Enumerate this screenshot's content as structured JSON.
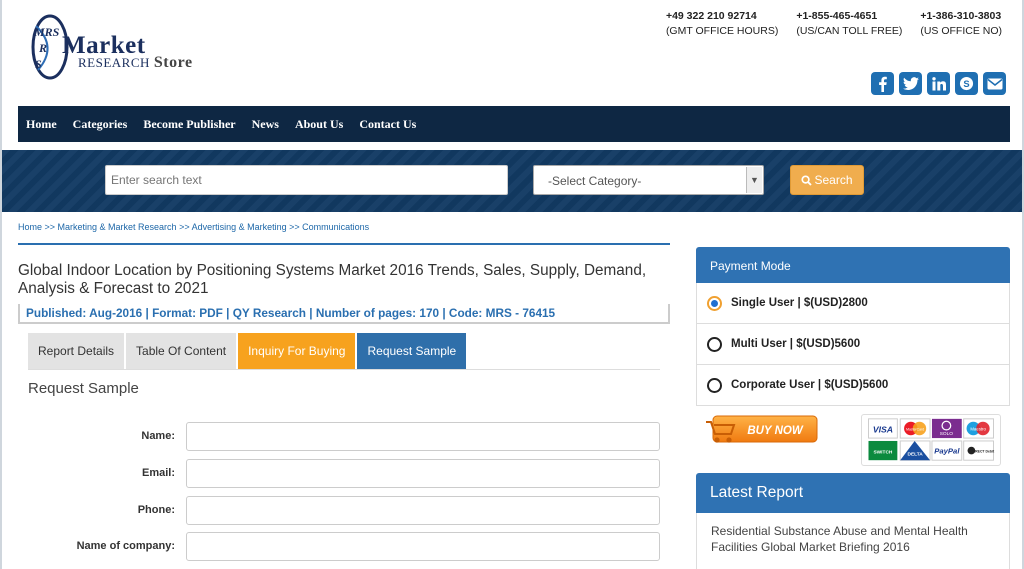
{
  "header": {
    "logo": {
      "mark": "MRS",
      "market": "Market",
      "research": "RESEARCH",
      "store": "Store"
    },
    "contacts": [
      {
        "number": "+49 322 210 92714",
        "note": "(GMT OFFICE HOURS)"
      },
      {
        "number": "+1-855-465-4651",
        "note": "(US/CAN TOLL FREE)"
      },
      {
        "number": "+1-386-310-3803",
        "note": "(US OFFICE NO)"
      }
    ],
    "socials": [
      "facebook-icon",
      "twitter-icon",
      "linkedin-icon",
      "skype-icon",
      "email-icon"
    ]
  },
  "nav": {
    "items": [
      "Home",
      "Categories",
      "Become Publisher",
      "News",
      "About Us",
      "Contact Us"
    ]
  },
  "search": {
    "placeholder": "Enter search text",
    "category": "-Select Category-",
    "button": "Search"
  },
  "breadcrumb": "Home >> Marketing & Market Research >> Advertising & Marketing >> Communications",
  "report": {
    "title": "Global Indoor Location by Positioning Systems Market 2016 Trends, Sales, Supply, Demand, Analysis & Forecast to 2021",
    "meta": "Published: Aug-2016 | Format: PDF | QY Research | Number of pages: 170 | Code: MRS - 76415"
  },
  "tabs": [
    "Report Details",
    "Table Of Content",
    "Inquiry For Buying",
    "Request Sample"
  ],
  "form": {
    "title": "Request Sample",
    "fields": [
      "Name:",
      "Email:",
      "Phone:",
      "Name of company:"
    ]
  },
  "payment": {
    "title": "Payment Mode",
    "options": [
      {
        "label": "Single User | $(USD)2800",
        "selected": true
      },
      {
        "label": "Multi User | $(USD)5600",
        "selected": false
      },
      {
        "label": "Corporate User | $(USD)5600",
        "selected": false
      }
    ],
    "buy_now": "BUY NOW",
    "cards": {
      "visa": "VISA",
      "mastercard": "MasterCard",
      "solo": "SOLO",
      "maestro": "Maestro",
      "switch": "SWITCH",
      "delta": "DELTA",
      "paypal": "PayPal",
      "direct_debit": "DIRECT Debit"
    }
  },
  "latest": {
    "title": "Latest Report",
    "items": [
      "Residential Substance Abuse and Mental Health Facilities Global Market Briefing 2016"
    ]
  }
}
